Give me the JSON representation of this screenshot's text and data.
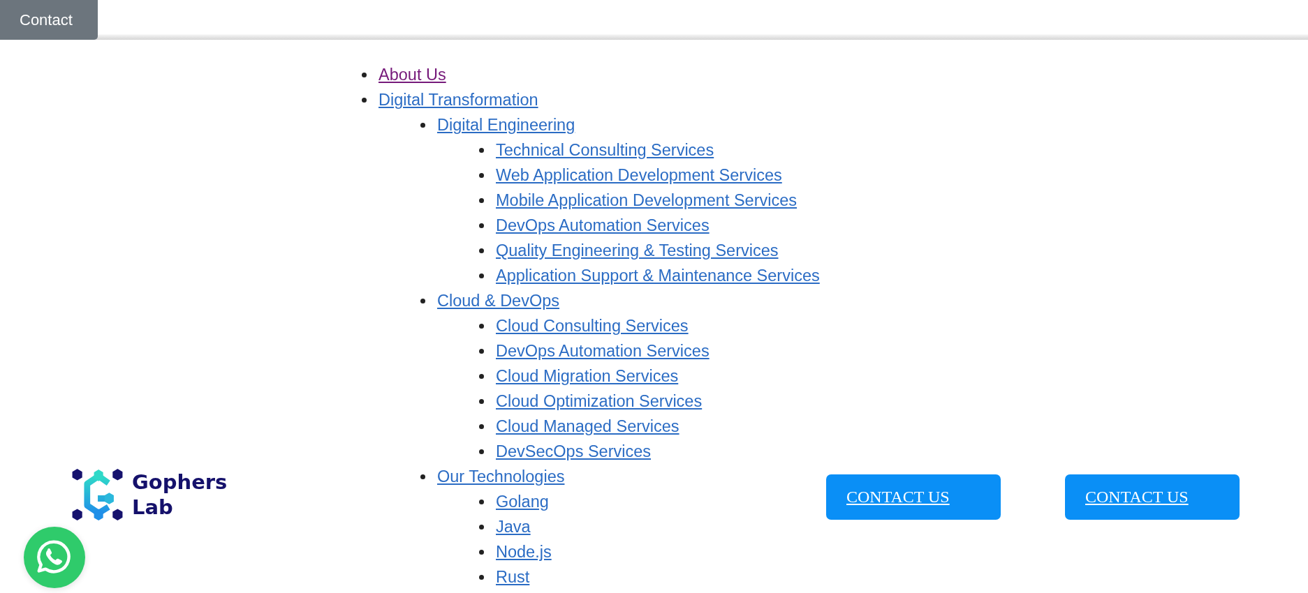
{
  "header": {
    "contact_button": "Contact"
  },
  "nav": [
    {
      "label": "About Us",
      "visited": true
    },
    {
      "label": "Digital Transformation",
      "visited": false,
      "children": [
        {
          "label": "Digital Engineering",
          "visited": false,
          "children": [
            {
              "label": "Technical Consulting Services",
              "visited": false
            },
            {
              "label": "Web Application Development Services",
              "visited": false
            },
            {
              "label": "Mobile Application Development Services",
              "visited": false
            },
            {
              "label": "DevOps Automation Services",
              "visited": false
            },
            {
              "label": "Quality Engineering & Testing Services",
              "visited": false
            },
            {
              "label": "Application Support & Maintenance Services",
              "visited": false
            }
          ]
        },
        {
          "label": "Cloud & DevOps",
          "visited": false,
          "children": [
            {
              "label": "Cloud Consulting Services",
              "visited": false
            },
            {
              "label": "DevOps Automation Services",
              "visited": false
            },
            {
              "label": "Cloud Migration Services",
              "visited": false
            },
            {
              "label": "Cloud Optimization Services",
              "visited": false
            },
            {
              "label": "Cloud Managed Services",
              "visited": false
            },
            {
              "label": "DevSecOps Services",
              "visited": false
            }
          ]
        },
        {
          "label": "Our Technologies",
          "visited": false,
          "children": [
            {
              "label": "Golang",
              "visited": false
            },
            {
              "label": "Java",
              "visited": false
            },
            {
              "label": "Node.js",
              "visited": false
            },
            {
              "label": "Rust",
              "visited": false
            }
          ]
        }
      ]
    }
  ],
  "logo": {
    "lines": [
      "Gophers",
      "Lab"
    ]
  },
  "contact_buttons": [
    "CONTACT US",
    "CONTACT US"
  ]
}
